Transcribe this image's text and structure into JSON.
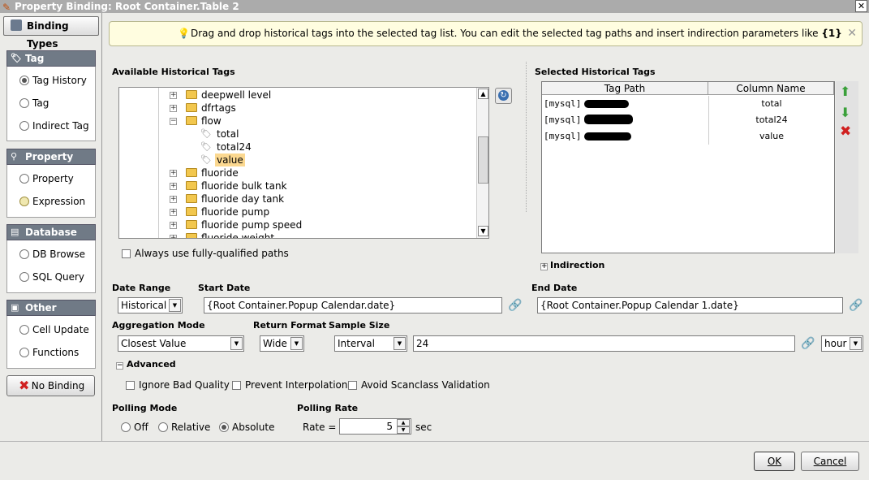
{
  "window": {
    "title": "Property Binding: Root Container.Table 2"
  },
  "sidebar": {
    "header": "Binding Types",
    "sections": [
      {
        "title": "Tag",
        "options": [
          "Tag History",
          "Tag",
          "Indirect Tag"
        ],
        "selected": "Tag History"
      },
      {
        "title": "Property",
        "options": [
          "Property",
          "Expression"
        ]
      },
      {
        "title": "Database",
        "options": [
          "DB Browse",
          "SQL Query"
        ]
      },
      {
        "title": "Other",
        "options": [
          "Cell Update",
          "Functions"
        ]
      }
    ],
    "no_binding_label": "No Binding"
  },
  "tooltip": {
    "text": "Drag and drop historical tags into the selected tag list. You can edit the selected tag paths and insert indirection parameters like ",
    "param": "{1}"
  },
  "available": {
    "title": "Available Historical Tags",
    "tree": [
      {
        "label": "deepwell level",
        "type": "folder"
      },
      {
        "label": "dfrtags",
        "type": "folder"
      },
      {
        "label": "flow",
        "type": "folder",
        "expanded": true
      },
      {
        "label": "total",
        "type": "tag"
      },
      {
        "label": "total24",
        "type": "tag"
      },
      {
        "label": "value",
        "type": "tag",
        "selected": true
      },
      {
        "label": "fluoride",
        "type": "folder"
      },
      {
        "label": "fluoride bulk tank",
        "type": "folder"
      },
      {
        "label": "fluoride day tank",
        "type": "folder"
      },
      {
        "label": "fluoride pump",
        "type": "folder"
      },
      {
        "label": "fluoride pump speed",
        "type": "folder"
      },
      {
        "label": "fluoride weight",
        "type": "folder"
      }
    ],
    "fully_qualified_label": "Always use fully-qualified paths"
  },
  "selected": {
    "title": "Selected Historical Tags",
    "columns": [
      "Tag Path",
      "Column Name"
    ],
    "rows": [
      {
        "path": "[mysql]",
        "column": "total"
      },
      {
        "path": "[mysql]",
        "column": "total24"
      },
      {
        "path": "[mysql]",
        "column": "value"
      }
    ],
    "indirection_label": "Indirection"
  },
  "date_range": {
    "label": "Date Range",
    "value": "Historical"
  },
  "start_date": {
    "label": "Start Date",
    "value": "{Root Container.Popup Calendar.date}"
  },
  "end_date": {
    "label": "End Date",
    "value": "{Root Container.Popup Calendar 1.date}"
  },
  "aggregation": {
    "label": "Aggregation Mode",
    "value": "Closest Value"
  },
  "return_format": {
    "label": "Return Format",
    "value": "Wide"
  },
  "sample_size": {
    "label": "Sample Size",
    "mode": "Interval",
    "value": "24",
    "unit": "hour"
  },
  "advanced": {
    "label": "Advanced",
    "options": [
      "Ignore Bad Quality",
      "Prevent Interpolation",
      "Avoid Scanclass Validation"
    ]
  },
  "polling": {
    "mode_label": "Polling Mode",
    "modes": [
      "Off",
      "Relative",
      "Absolute"
    ],
    "selected": "Absolute",
    "rate_label": "Polling Rate",
    "rate_prefix": "Rate =",
    "rate_value": "5",
    "rate_unit": "sec"
  },
  "buttons": {
    "ok": "OK",
    "cancel": "Cancel"
  }
}
